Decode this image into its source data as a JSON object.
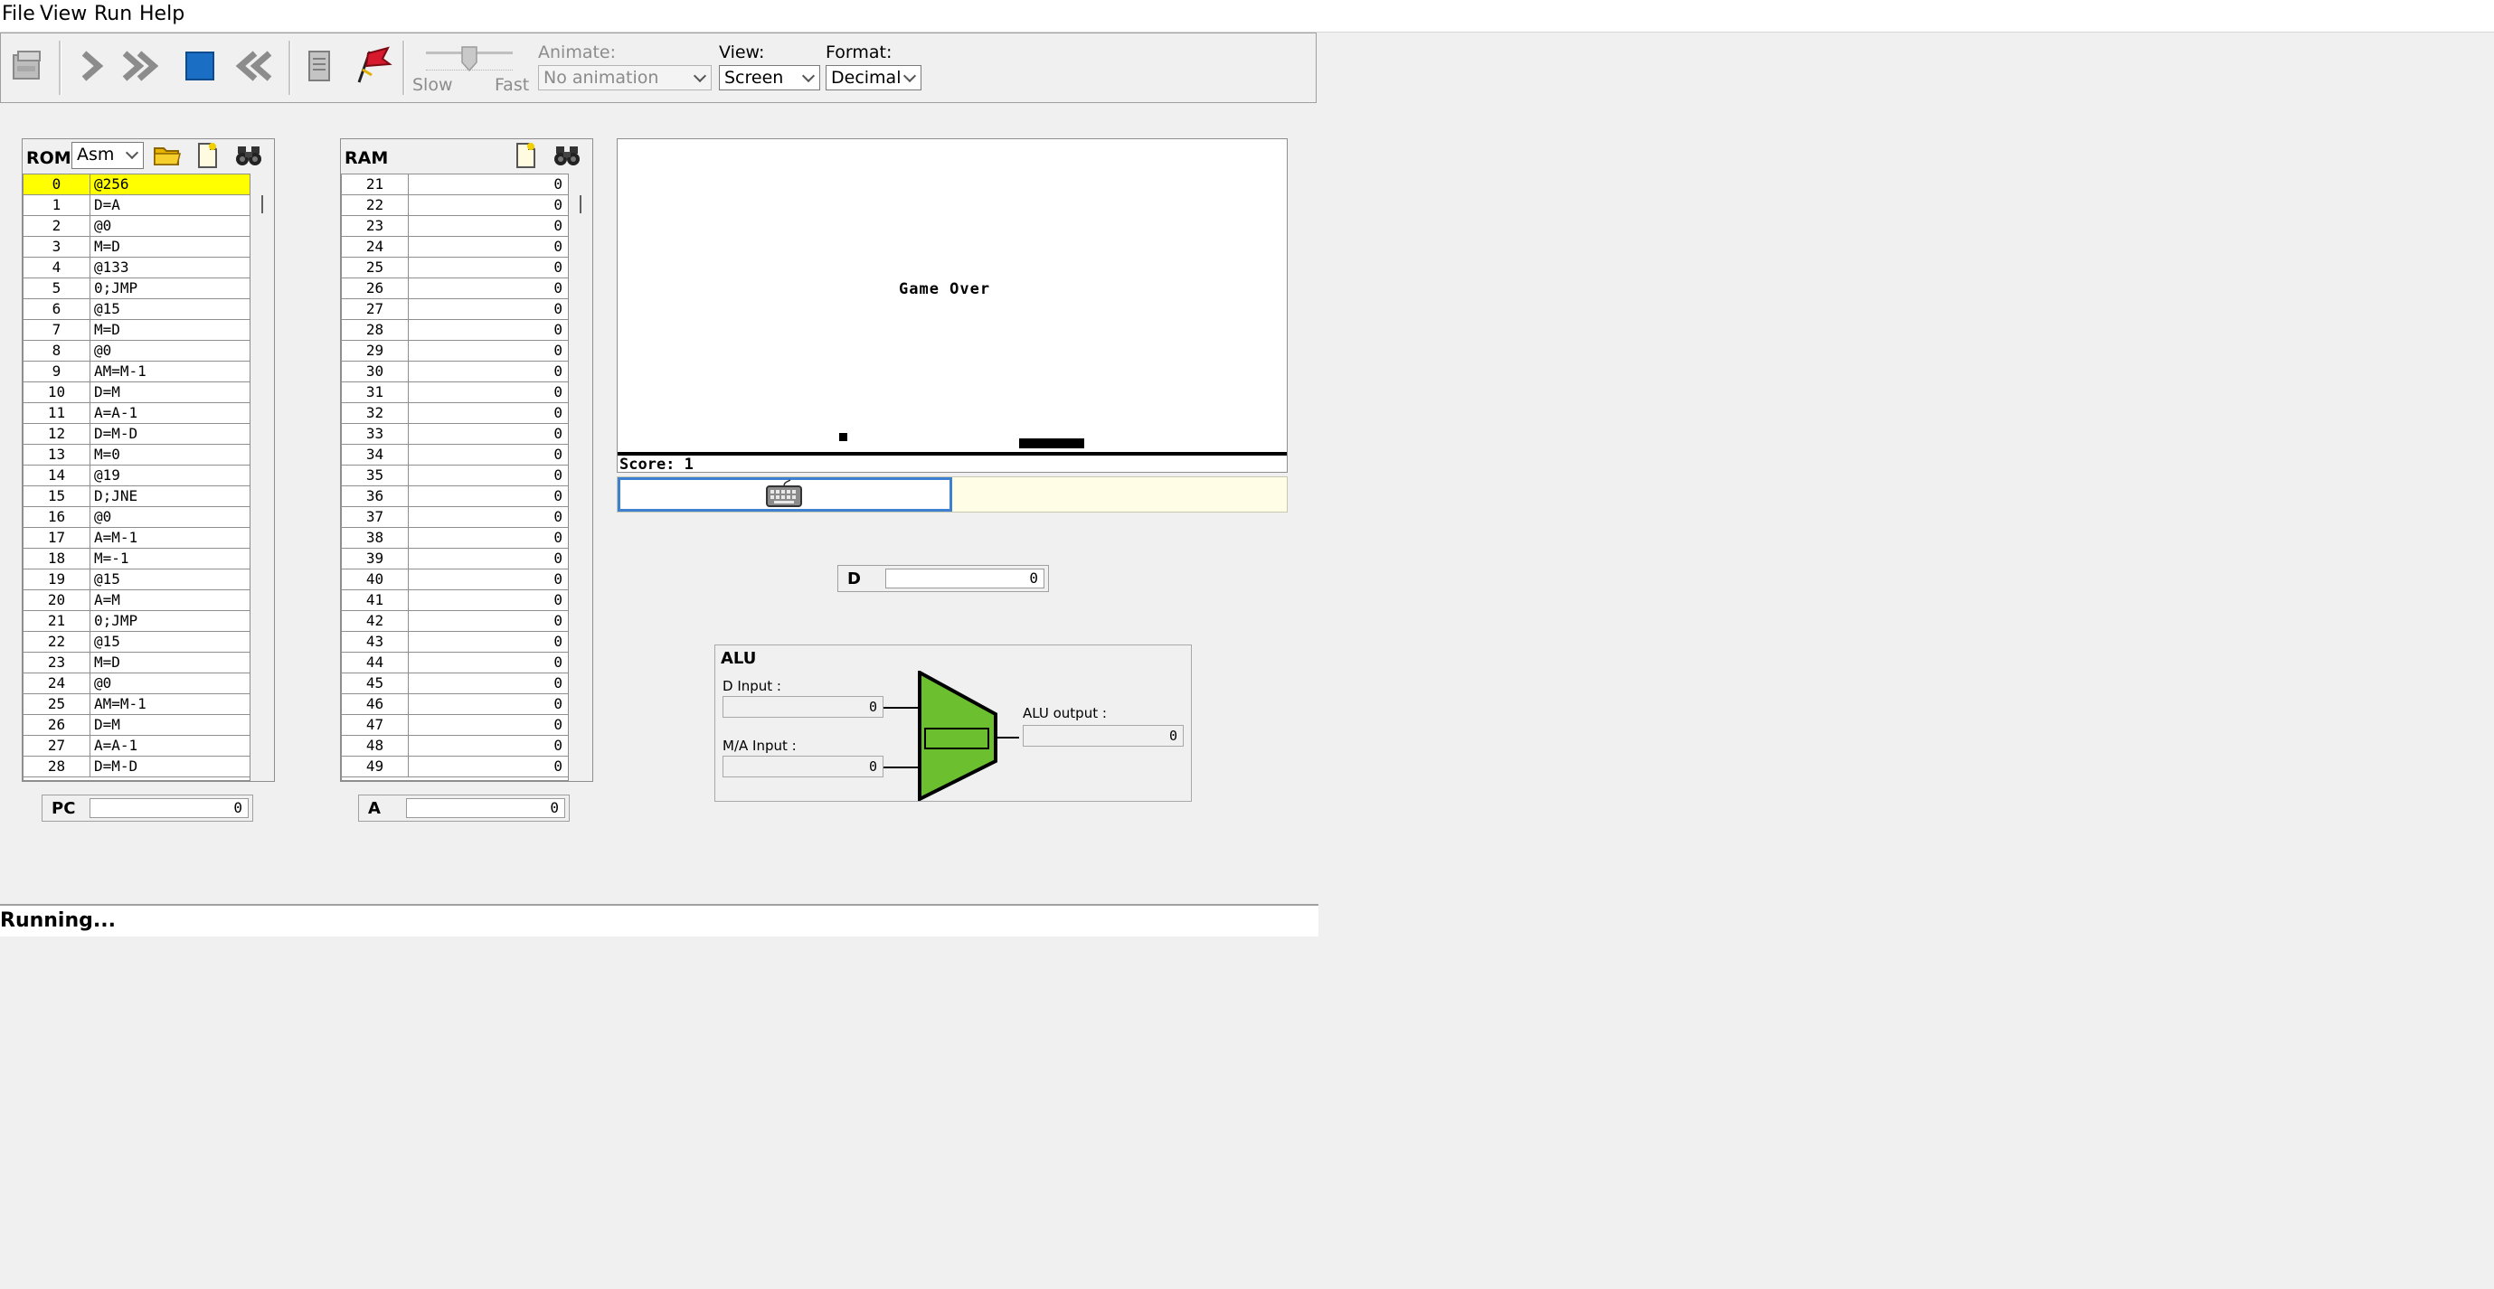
{
  "menu": [
    "File",
    "View",
    "Run",
    "Help"
  ],
  "toolbar": {
    "slow_label": "Slow",
    "fast_label": "Fast",
    "slider_value": 0.5,
    "animate_label": "Animate:",
    "animate_value": "No animation",
    "view_label": "View:",
    "view_value": "Screen",
    "format_label": "Format:",
    "format_value": "Decimal"
  },
  "rom": {
    "title": "ROM",
    "format_value": "Asm",
    "rows": [
      [
        "0",
        "@256"
      ],
      [
        "1",
        "D=A"
      ],
      [
        "2",
        "@0"
      ],
      [
        "3",
        "M=D"
      ],
      [
        "4",
        "@133"
      ],
      [
        "5",
        "0;JMP"
      ],
      [
        "6",
        "@15"
      ],
      [
        "7",
        "M=D"
      ],
      [
        "8",
        "@0"
      ],
      [
        "9",
        "AM=M-1"
      ],
      [
        "10",
        "D=M"
      ],
      [
        "11",
        "A=A-1"
      ],
      [
        "12",
        "D=M-D"
      ],
      [
        "13",
        "M=0"
      ],
      [
        "14",
        "@19"
      ],
      [
        "15",
        "D;JNE"
      ],
      [
        "16",
        "@0"
      ],
      [
        "17",
        "A=M-1"
      ],
      [
        "18",
        "M=-1"
      ],
      [
        "19",
        "@15"
      ],
      [
        "20",
        "A=M"
      ],
      [
        "21",
        "0;JMP"
      ],
      [
        "22",
        "@15"
      ],
      [
        "23",
        "M=D"
      ],
      [
        "24",
        "@0"
      ],
      [
        "25",
        "AM=M-1"
      ],
      [
        "26",
        "D=M"
      ],
      [
        "27",
        "A=A-1"
      ],
      [
        "28",
        "D=M-D"
      ]
    ]
  },
  "ram": {
    "title": "RAM",
    "rows": [
      [
        "21",
        "0"
      ],
      [
        "22",
        "0"
      ],
      [
        "23",
        "0"
      ],
      [
        "24",
        "0"
      ],
      [
        "25",
        "0"
      ],
      [
        "26",
        "0"
      ],
      [
        "27",
        "0"
      ],
      [
        "28",
        "0"
      ],
      [
        "29",
        "0"
      ],
      [
        "30",
        "0"
      ],
      [
        "31",
        "0"
      ],
      [
        "32",
        "0"
      ],
      [
        "33",
        "0"
      ],
      [
        "34",
        "0"
      ],
      [
        "35",
        "0"
      ],
      [
        "36",
        "0"
      ],
      [
        "37",
        "0"
      ],
      [
        "38",
        "0"
      ],
      [
        "39",
        "0"
      ],
      [
        "40",
        "0"
      ],
      [
        "41",
        "0"
      ],
      [
        "42",
        "0"
      ],
      [
        "43",
        "0"
      ],
      [
        "44",
        "0"
      ],
      [
        "45",
        "0"
      ],
      [
        "46",
        "0"
      ],
      [
        "47",
        "0"
      ],
      [
        "48",
        "0"
      ],
      [
        "49",
        "0"
      ]
    ]
  },
  "registers": {
    "pc_label": "PC",
    "pc_value": "0",
    "a_label": "A",
    "a_value": "0",
    "d_label": "D",
    "d_value": "0"
  },
  "screen": {
    "game_over": "Game Over",
    "score": "Score: 1"
  },
  "alu": {
    "title": "ALU",
    "d_input_label": "D Input :",
    "d_input_value": "0",
    "ma_input_label": "M/A Input :",
    "ma_input_value": "0",
    "output_label": "ALU output :",
    "output_value": "0",
    "color": "#6cbf2e"
  },
  "status": "Running...",
  "colors": {
    "highlight": "#ffff00",
    "stop_button": "#1a6fc4",
    "keyboard_focus": "#3d7fd1",
    "keyboard_bar": "#fffde6"
  }
}
